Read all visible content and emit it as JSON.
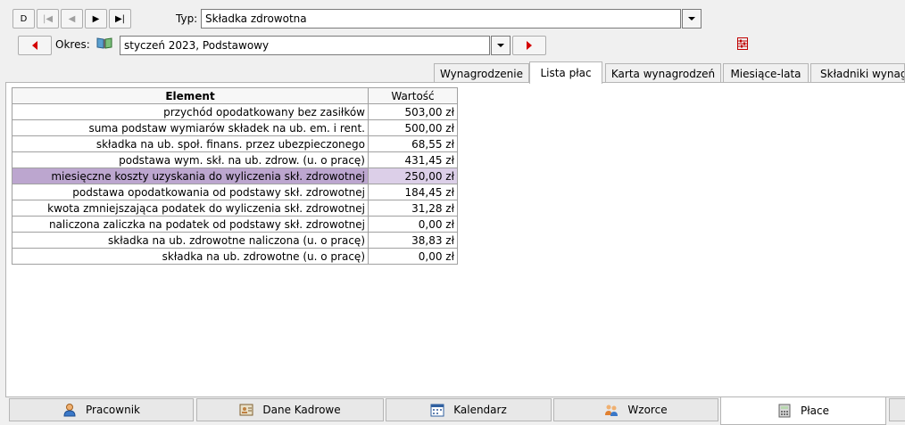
{
  "toolbar": {
    "nav": [
      {
        "name": "first",
        "glyph": "D",
        "enabled": true
      },
      {
        "name": "prev-first",
        "glyph": "|◀",
        "enabled": false
      },
      {
        "name": "prev",
        "glyph": "◀",
        "enabled": false
      },
      {
        "name": "next",
        "glyph": "▶",
        "enabled": true
      },
      {
        "name": "last",
        "glyph": "▶|",
        "enabled": true
      }
    ],
    "typ_label": "Typ:",
    "typ_value": "Składka zdrowotna",
    "okres_label": "Okres:",
    "okres_value": "styczeń 2023, Podstawowy"
  },
  "tabs": [
    {
      "label": "Wynagrodzenie",
      "active": false
    },
    {
      "label": "Lista płac",
      "active": true
    },
    {
      "label": "Karta wynagrodzeń",
      "active": false
    },
    {
      "label": "Miesiące-lata",
      "active": false
    },
    {
      "label": "Składniki wynagrodzeń",
      "active": false
    }
  ],
  "grid": {
    "header_element": "Element",
    "header_value": "Wartość",
    "rows": [
      {
        "element": "przychód opodatkowany bez zasiłków",
        "value": "503,00 zł"
      },
      {
        "element": "suma podstaw wymiarów składek na ub. em. i rent.",
        "value": "500,00 zł"
      },
      {
        "element": "składka na ub. społ. finans. przez ubezpieczonego",
        "value": "68,55 zł"
      },
      {
        "element": "podstawa wym. skł. na ub. zdrow. (u. o pracę)",
        "value": "431,45 zł"
      },
      {
        "element": "miesięczne koszty uzyskania do wyliczenia skł. zdrowotnej",
        "value": "250,00 zł",
        "selected": true
      },
      {
        "element": "podstawa opodatkowania od podstawy skł. zdrowotnej",
        "value": "184,45 zł"
      },
      {
        "element": "kwota zmniejszająca podatek do wyliczenia skł. zdrowotnej",
        "value": "31,28 zł"
      },
      {
        "element": "naliczona zaliczka na podatek od podstawy skł. zdrowotnej",
        "value": "0,00 zł"
      },
      {
        "element": "składka na ub. zdrowotne naliczona (u. o pracę)",
        "value": "38,83 zł"
      },
      {
        "element": "składka na ub. zdrowotne (u. o pracę)",
        "value": "0,00 zł"
      }
    ]
  },
  "bottom_tabs": [
    {
      "label": "Pracownik",
      "icon": "person-icon",
      "active": false
    },
    {
      "label": "Dane Kadrowe",
      "icon": "id-card-icon",
      "active": false
    },
    {
      "label": "Kalendarz",
      "icon": "calendar-icon",
      "active": false
    },
    {
      "label": "Wzorce",
      "icon": "people-icon",
      "active": false
    },
    {
      "label": "Płace",
      "icon": "calculator-icon",
      "active": true
    }
  ],
  "colors": {
    "selected_row": "#bca6cf",
    "selected_value": "#dccfe8",
    "arrow_red": "#d40000"
  }
}
